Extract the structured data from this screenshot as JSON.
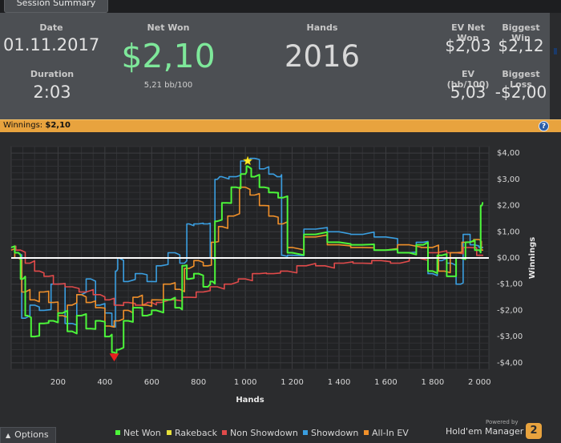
{
  "tab": {
    "label": "Session Summary"
  },
  "summary": {
    "date_label": "Date",
    "date_value": "01.11.2017",
    "duration_label": "Duration",
    "duration_value": "2:03",
    "netwon_label": "Net Won",
    "netwon_value": "$2,10",
    "bb_value": "5,21 bb/100",
    "hands_label": "Hands",
    "hands_value": "2016",
    "ev_net_label": "EV Net Won",
    "ev_net_value": "$2,03",
    "biggest_win_label": "Biggest Win",
    "biggest_win_value": "$2,12",
    "ev_bb_label": "EV (bb/100)",
    "ev_bb_value": "5,03",
    "biggest_loss_label": "Biggest Loss",
    "biggest_loss_value": "-$2,00"
  },
  "winbar": {
    "label": "Winnings:",
    "value": "$2,10",
    "help": "?"
  },
  "footer": {
    "options_label": "Options",
    "powered": "Powered by",
    "brand": "Hold'em Manager",
    "badge": "2"
  },
  "colors": {
    "net_won": "#4cf53a",
    "rakeback": "#e6e03a",
    "non_showdown": "#e04a4a",
    "showdown": "#3a9ee0",
    "all_in_ev": "#f0902a",
    "accent": "#e8a33e"
  },
  "chart_data": {
    "type": "line",
    "xlabel": "Hands",
    "ylabel": "Winnings",
    "xlim": [
      0,
      2040
    ],
    "ylim": [
      -4.25,
      4.25
    ],
    "x_ticks": [
      200,
      400,
      600,
      800,
      1000,
      1200,
      1400,
      1600,
      1800,
      2000
    ],
    "x_tick_labels": [
      "200",
      "400",
      "600",
      "800",
      "1 000",
      "1 200",
      "1 400",
      "1 600",
      "1 800",
      "2 000"
    ],
    "y_ticks": [
      4,
      3,
      2,
      1,
      0,
      -1,
      -2,
      -3,
      -4
    ],
    "y_tick_labels": [
      "$4,00",
      "$3,00",
      "$2,00",
      "$1,00",
      "$0,00",
      "-$1,00",
      "-$2,00",
      "-$3,00",
      "-$4,00"
    ],
    "grid": true,
    "annotations": [
      {
        "label": "max",
        "x": 1010,
        "y": 3.7
      },
      {
        "label": "min",
        "x": 440,
        "y": -3.8
      }
    ],
    "series": [
      {
        "name": "Showdown",
        "color": "#3a9ee0",
        "x": [
          0,
          30,
          60,
          100,
          140,
          200,
          260,
          300,
          340,
          380,
          420,
          440,
          450,
          460,
          500,
          560,
          600,
          640,
          700,
          740,
          760,
          800,
          840,
          860,
          880,
          900,
          960,
          1000,
          1040,
          1080,
          1120,
          1150,
          1160,
          1200,
          1300,
          1400,
          1500,
          1600,
          1700,
          1760,
          1800,
          1840,
          1880,
          1920,
          1940,
          1980,
          2016
        ],
        "y": [
          0.4,
          0.2,
          -2.3,
          -1.8,
          -2.0,
          -1.0,
          -2.5,
          -1.4,
          -0.8,
          -1.8,
          -2.1,
          -2.6,
          -0.5,
          0.0,
          -0.9,
          -0.6,
          -0.9,
          -0.3,
          0.2,
          -0.2,
          1.3,
          1.3,
          1.3,
          0.0,
          3.0,
          3.1,
          3.1,
          3.7,
          3.8,
          3.4,
          3.2,
          3.1,
          0.1,
          0.1,
          1.1,
          1.0,
          0.9,
          0.8,
          0.2,
          0.6,
          -0.6,
          -0.1,
          -0.2,
          -1.0,
          0.9,
          0.5,
          0.4
        ]
      },
      {
        "name": "Non Showdown",
        "color": "#e04a4a",
        "x": [
          0,
          40,
          80,
          120,
          160,
          200,
          260,
          320,
          380,
          420,
          460,
          500,
          560,
          600,
          640,
          700,
          760,
          820,
          880,
          940,
          1000,
          1060,
          1120,
          1180,
          1260,
          1340,
          1420,
          1500,
          1580,
          1660,
          1740,
          1820,
          1900,
          1960,
          2016
        ],
        "y": [
          0.4,
          0.3,
          -0.2,
          -0.5,
          -0.7,
          -1.0,
          -1.1,
          -1.3,
          -1.4,
          -1.6,
          -1.8,
          -1.7,
          -1.8,
          -1.7,
          -1.7,
          -1.6,
          -1.5,
          -1.3,
          -1.1,
          -1.0,
          -0.8,
          -0.6,
          -0.6,
          -0.5,
          -0.3,
          -0.3,
          -0.2,
          -0.2,
          -0.1,
          -0.2,
          0.0,
          0.2,
          0.2,
          0.4,
          0.1
        ]
      },
      {
        "name": "All-In EV",
        "color": "#f0902a",
        "x": [
          0,
          30,
          60,
          100,
          140,
          180,
          220,
          260,
          300,
          340,
          380,
          420,
          460,
          500,
          540,
          580,
          620,
          680,
          720,
          760,
          800,
          840,
          870,
          900,
          950,
          1000,
          1040,
          1080,
          1120,
          1160,
          1200,
          1300,
          1400,
          1500,
          1600,
          1700,
          1800,
          1850,
          1900,
          1950,
          2000,
          2016
        ],
        "y": [
          0.3,
          0.0,
          -1.3,
          -1.6,
          -1.3,
          -1.7,
          -2.2,
          -1.8,
          -1.4,
          -1.7,
          -1.9,
          -2.6,
          -2.4,
          -2.0,
          -1.5,
          -1.8,
          -1.6,
          -1.0,
          -1.2,
          -0.4,
          -0.1,
          -0.3,
          0.6,
          1.2,
          1.6,
          2.7,
          2.4,
          2.0,
          1.6,
          1.3,
          0.4,
          0.8,
          0.5,
          0.4,
          0.3,
          0.5,
          0.4,
          -0.5,
          0.2,
          0.6,
          0.7,
          0.3
        ]
      },
      {
        "name": "Net Won",
        "color": "#4cf53a",
        "x": [
          0,
          30,
          50,
          70,
          100,
          140,
          180,
          220,
          260,
          300,
          340,
          380,
          420,
          440,
          460,
          500,
          540,
          580,
          620,
          680,
          720,
          740,
          760,
          800,
          840,
          860,
          880,
          920,
          960,
          1000,
          1010,
          1040,
          1080,
          1120,
          1160,
          1200,
          1300,
          1400,
          1500,
          1600,
          1700,
          1760,
          1800,
          1840,
          1880,
          1920,
          1960,
          2000,
          2010,
          2016
        ],
        "y": [
          0.4,
          0.2,
          -0.8,
          -2.2,
          -3.0,
          -2.5,
          -2.4,
          -2.1,
          -2.8,
          -2.2,
          -2.7,
          -2.4,
          -3.0,
          -3.6,
          -3.5,
          -2.4,
          -1.9,
          -2.2,
          -2.0,
          -1.6,
          -1.9,
          -0.3,
          -0.8,
          -0.6,
          -1.1,
          -0.9,
          1.4,
          2.1,
          2.7,
          3.2,
          3.5,
          3.1,
          2.7,
          2.5,
          2.3,
          0.2,
          0.9,
          0.6,
          0.5,
          0.3,
          0.2,
          0.5,
          -0.5,
          0.1,
          -0.7,
          0.0,
          0.6,
          0.3,
          2.0,
          2.1
        ]
      }
    ]
  }
}
